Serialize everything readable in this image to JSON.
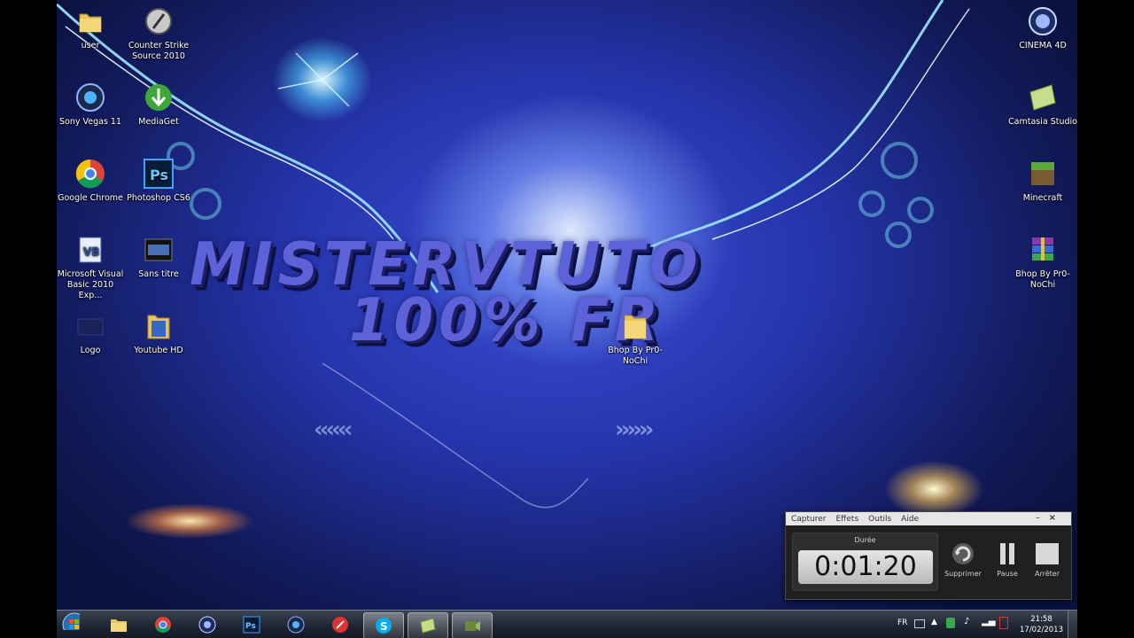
{
  "desktop": {
    "brand_line1": "MISTERVTUTO",
    "brand_line2": "100% FR",
    "icons": [
      {
        "label": "user",
        "icon": "folder-icon"
      },
      {
        "label": "Counter Strike Source 2010",
        "icon": "counter-strike-icon"
      },
      {
        "label": "Sony Vegas 11",
        "icon": "sony-vegas-icon"
      },
      {
        "label": "MediaGet",
        "icon": "mediaget-icon"
      },
      {
        "label": "Google Chrome",
        "icon": "chrome-icon"
      },
      {
        "label": "Photoshop CS6",
        "icon": "photoshop-icon"
      },
      {
        "label": "Microsoft Visual Basic 2010 Exp...",
        "icon": "visual-basic-icon"
      },
      {
        "label": "Sans titre",
        "icon": "video-file-icon"
      },
      {
        "label": "Logo",
        "icon": "image-file-icon"
      },
      {
        "label": "Youtube HD",
        "icon": "folder-icon"
      },
      {
        "label": "Bhop By Pr0-NoChi",
        "icon": "folder-icon"
      },
      {
        "label": "CINEMA 4D",
        "icon": "cinema4d-icon"
      },
      {
        "label": "Camtasia Studio",
        "icon": "camtasia-icon"
      },
      {
        "label": "Minecraft",
        "icon": "minecraft-icon"
      },
      {
        "label": "Bhop By Pr0-NoChi",
        "icon": "winrar-icon"
      }
    ]
  },
  "recorder": {
    "menu": [
      "Capturer",
      "Effets",
      "Outils",
      "Aide"
    ],
    "minimize": "–",
    "close": "×",
    "duration_label": "Durée",
    "timer": "0:01:20",
    "buttons": {
      "delete": "Supprimer",
      "pause": "Pause",
      "stop": "Arrêter"
    }
  },
  "taskbar": {
    "apps": [
      "start-orb",
      "explorer-icon",
      "chrome-icon",
      "cinema4d-icon",
      "photoshop-icon",
      "sony-vegas-icon",
      "ccleaner-icon",
      "skype-icon",
      "camtasia-icon",
      "camtasia-recorder-icon"
    ],
    "active": [
      "skype-icon",
      "camtasia-icon",
      "camtasia-recorder-icon"
    ],
    "language": "FR",
    "time": "21:58",
    "date": "17/02/2013"
  }
}
